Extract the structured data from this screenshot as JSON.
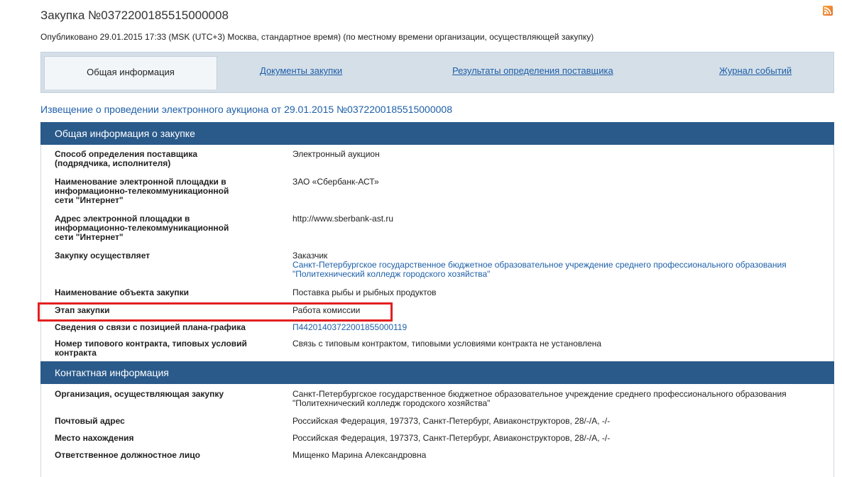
{
  "page": {
    "title": "Закупка №0372200185515000008",
    "published": "Опубликовано 29.01.2015 17:33 (MSK (UTC+3) Москва, стандартное время) (по местному времени организации, осуществляющей закупку)"
  },
  "icons": {
    "rss": "rss-icon"
  },
  "tabs": [
    {
      "label": "Общая информация",
      "active": true
    },
    {
      "label": "Документы закупки",
      "active": false
    },
    {
      "label": "Результаты определения поставщика",
      "active": false
    },
    {
      "label": "Журнал событий",
      "active": false
    }
  ],
  "notice_title": "Извещение о проведении электронного аукциона от 29.01.2015 №0372200185515000008",
  "general": {
    "header": "Общая информация о закупке",
    "rows": [
      {
        "label_lines": [
          "Способ определения поставщика",
          "(подрядчика, исполнителя)"
        ],
        "value": "Электронный аукцион"
      },
      {
        "label_lines": [
          "Наименование электронной площадки в",
          "информационно-телекоммуникационной",
          "сети \"Интернет\""
        ],
        "value": "ЗАО «Сбербанк-АСТ»"
      },
      {
        "label_lines": [
          "Адрес электронной площадки в",
          "информационно-телекоммуникационной",
          "сети \"Интернет\""
        ],
        "value": "http://www.sberbank-ast.ru"
      },
      {
        "label_lines": [
          "Закупку осуществляет"
        ],
        "value": "Заказчик",
        "value_link_lines": [
          "Санкт-Петербургское государственное бюджетное образовательное учреждение среднего профессионального образования",
          "\"Политехнический колледж городского хозяйства\""
        ]
      },
      {
        "label_lines": [
          "Наименование объекта закупки"
        ],
        "value": "Поставка рыбы и рыбных продуктов"
      },
      {
        "label_lines": [
          "Этап закупки"
        ],
        "value": "Работа комиссии"
      },
      {
        "label_lines": [
          "Сведения о связи с позицией плана-графика"
        ],
        "value": "П44201403722001855000119"
      },
      {
        "label_lines": [
          "Номер типового контракта, типовых условий",
          "контракта"
        ],
        "value": "Связь с типовым контрактом, типовыми условиями контракта не установлена"
      }
    ]
  },
  "contact": {
    "header": "Контактная информация",
    "rows": [
      {
        "label_lines": [
          "Организация, осуществляющая закупку"
        ],
        "value_lines": [
          "Санкт-Петербургское государственное бюджетное образовательное учреждение среднего профессионального образования",
          "\"Политехнический колледж городского хозяйства\""
        ]
      },
      {
        "label_lines": [
          "Почтовый адрес"
        ],
        "value": "Российская Федерация, 197373, Санкт-Петербург, Авиаконструкторов, 28/-/А, -/-"
      },
      {
        "label_lines": [
          "Место нахождения"
        ],
        "value": "Российская Федерация, 197373, Санкт-Петербург, Авиаконструкторов, 28/-/А, -/-"
      },
      {
        "label_lines": [
          "Ответственное должностное лицо"
        ],
        "value": "Мищенко Марина Александровна"
      }
    ]
  }
}
